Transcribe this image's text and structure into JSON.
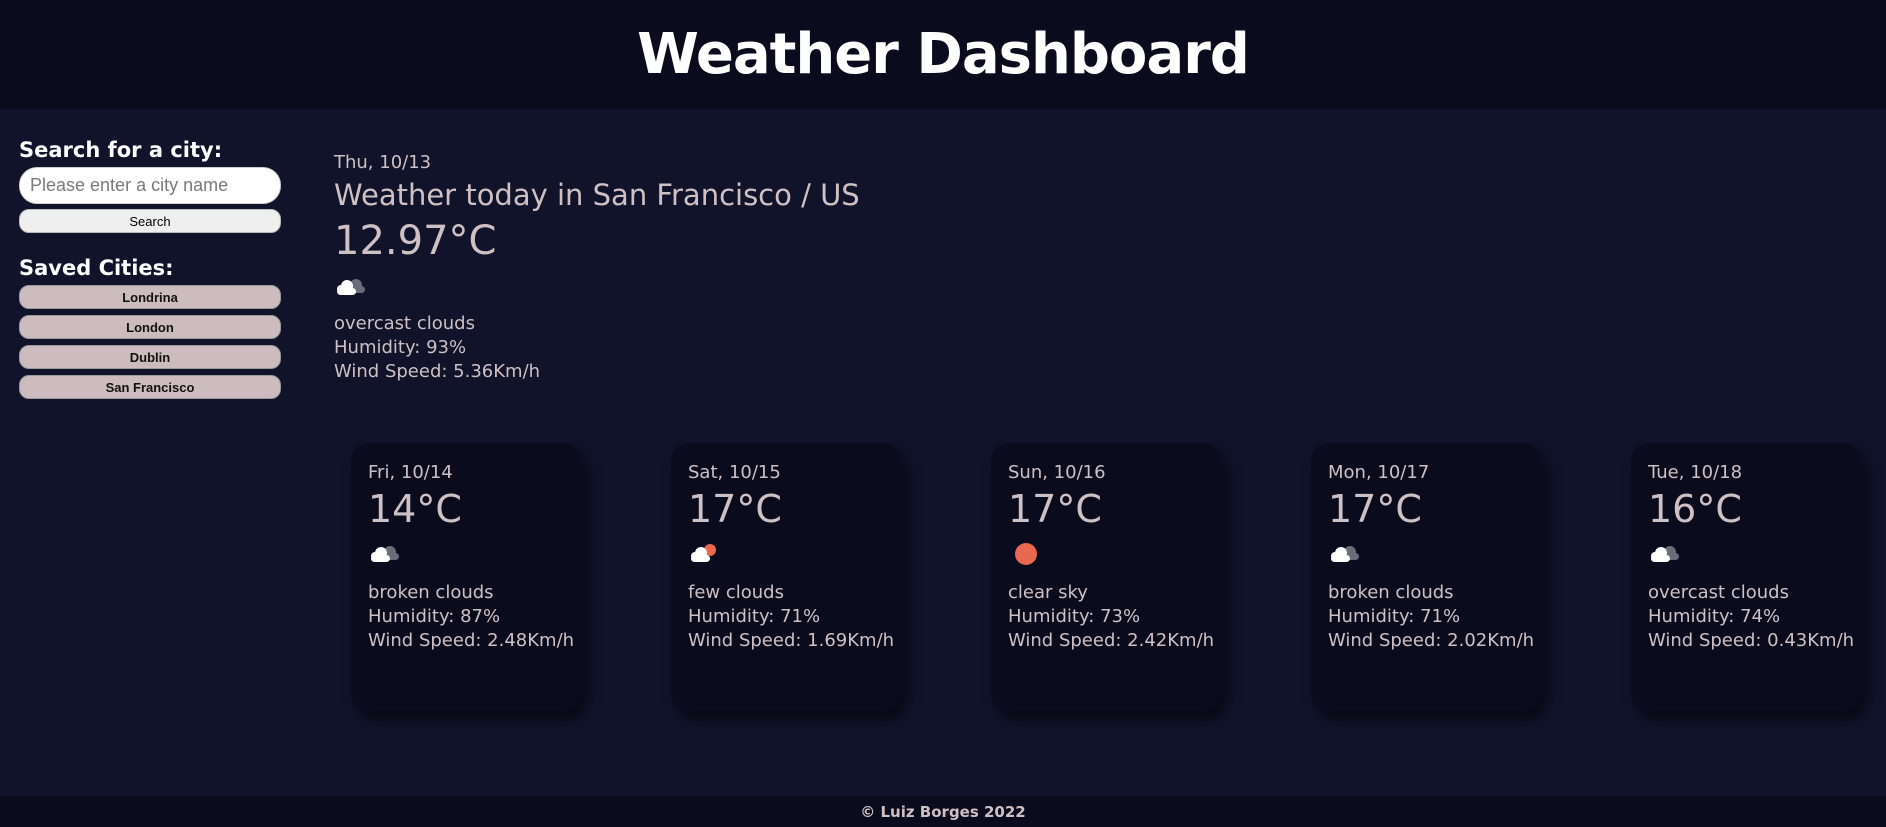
{
  "header": {
    "title": "Weather Dashboard"
  },
  "sidebar": {
    "search_title": "Search for a city:",
    "search_placeholder": "Please enter a city name",
    "search_button": "Search",
    "saved_title": "Saved Cities:",
    "cities": [
      "Londrina",
      "London",
      "Dublin",
      "San Francisco"
    ]
  },
  "current": {
    "date": "Thu, 10/13",
    "title": "Weather today in San Francisco / US",
    "temp": "12.97°C",
    "icon": "overcast-clouds-icon",
    "description": "overcast clouds",
    "humidity": "Humidity: 93%",
    "wind": "Wind Speed: 5.36Km/h"
  },
  "forecast": [
    {
      "date": "Fri, 10/14",
      "temp": "14°C",
      "icon": "broken-clouds-icon",
      "description": "broken clouds",
      "humidity": "Humidity: 87%",
      "wind": "Wind Speed: 2.48Km/h"
    },
    {
      "date": "Sat, 10/15",
      "temp": "17°C",
      "icon": "few-clouds-icon",
      "description": "few clouds",
      "humidity": "Humidity: 71%",
      "wind": "Wind Speed: 1.69Km/h"
    },
    {
      "date": "Sun, 10/16",
      "temp": "17°C",
      "icon": "clear-sky-icon",
      "description": "clear sky",
      "humidity": "Humidity: 73%",
      "wind": "Wind Speed: 2.42Km/h"
    },
    {
      "date": "Mon, 10/17",
      "temp": "17°C",
      "icon": "broken-clouds-icon",
      "description": "broken clouds",
      "humidity": "Humidity: 71%",
      "wind": "Wind Speed: 2.02Km/h"
    },
    {
      "date": "Tue, 10/18",
      "temp": "16°C",
      "icon": "overcast-clouds-icon",
      "description": "overcast clouds",
      "humidity": "Humidity: 74%",
      "wind": "Wind Speed: 0.43Km/h"
    }
  ],
  "footer": {
    "text": "© Luiz Borges 2022"
  },
  "colors": {
    "background": "#10132a",
    "header_bg": "#0a0c1e",
    "text": "#cfc0c3",
    "sun": "#e8694f",
    "city_button": "#cdbcbf"
  }
}
